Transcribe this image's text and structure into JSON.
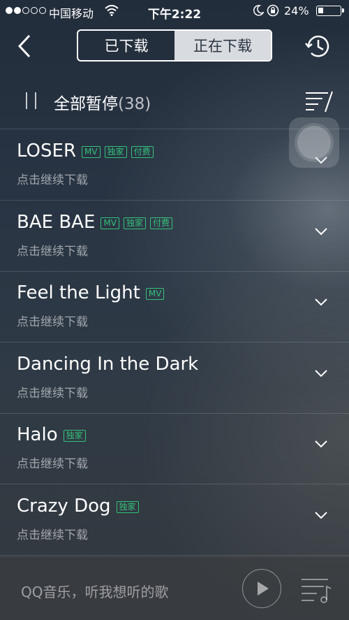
{
  "status": {
    "carrier": "中国移动",
    "time": "下午2:22",
    "battery": "24%"
  },
  "nav": {
    "tab_downloaded": "已下载",
    "tab_downloading": "正在下载"
  },
  "header": {
    "pause_all": "全部暂停",
    "count": "(38)"
  },
  "songs": [
    {
      "title": "LOSER",
      "badges": [
        "MV",
        "独家",
        "付费"
      ],
      "status": "点击继续下载"
    },
    {
      "title": "BAE BAE",
      "badges": [
        "MV",
        "独家",
        "付费"
      ],
      "status": "点击继续下载"
    },
    {
      "title": "Feel the Light",
      "badges": [
        "MV"
      ],
      "status": "点击继续下载"
    },
    {
      "title": "Dancing In the Dark",
      "badges": [],
      "status": "点击继续下载"
    },
    {
      "title": "Halo",
      "badges": [
        "独家"
      ],
      "status": "点击继续下载"
    },
    {
      "title": "Crazy Dog",
      "badges": [
        "独家"
      ],
      "status": "点击继续下载"
    }
  ],
  "bottom": {
    "slogan": "QQ音乐，听我想听的歌"
  },
  "colors": {
    "badge": "#34c27a",
    "segment_active_bg": "#d8dbdf"
  },
  "icons": [
    "back-icon",
    "history-icon",
    "pause-icon",
    "sort-icon",
    "chevron-down-icon",
    "play-icon",
    "playlist-icon"
  ]
}
